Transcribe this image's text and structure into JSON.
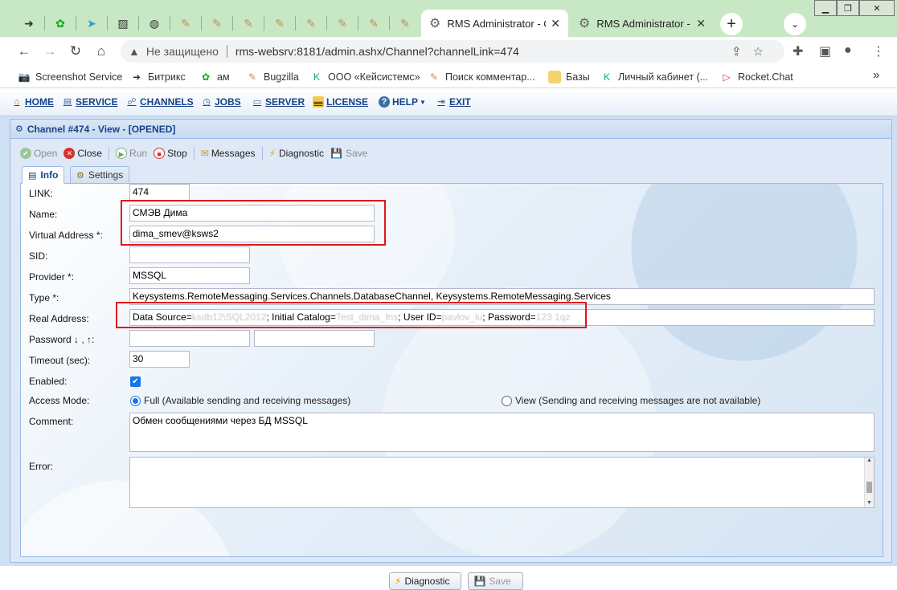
{
  "browser": {
    "tabs": [
      {
        "title": "RMS Administrator - C",
        "active": true
      },
      {
        "title": "RMS Administrator - N",
        "active": false
      }
    ],
    "address": {
      "security_label": "Не защищено",
      "url": "rms-websrv:8181/admin.ashx/Channel?channelLink=474"
    },
    "bookmarks": [
      "Screenshot Service",
      "Битрикс",
      "ам",
      "Bugzilla",
      "ООО «Кейсистемс»",
      "Поиск комментар...",
      "Базы",
      "Личный кабинет (...",
      "Rocket.Chat"
    ],
    "bookmarks_more": "»"
  },
  "menu": {
    "home": "HOME",
    "service": "SERVICE",
    "channels": "CHANNELS",
    "jobs": "JOBS",
    "server": "SERVER",
    "license": "LICENSE",
    "help": "HELP",
    "exit": "EXIT"
  },
  "panel": {
    "title": "Channel #474 - View - [OPENED]",
    "toolbar": {
      "open": "Open",
      "close": "Close",
      "run": "Run",
      "stop": "Stop",
      "messages": "Messages",
      "diagnostic": "Diagnostic",
      "save": "Save"
    },
    "tabs": {
      "info": "Info",
      "settings": "Settings"
    }
  },
  "form": {
    "link": {
      "label": "LINK:",
      "value": "474"
    },
    "name": {
      "label": "Name:",
      "value": "СМЭВ Дима"
    },
    "virtual_address": {
      "label": "Virtual Address *:",
      "value": "dima_smev@ksws2"
    },
    "sid": {
      "label": "SID:",
      "value": ""
    },
    "provider": {
      "label": "Provider *:",
      "value": "MSSQL"
    },
    "type": {
      "label": "Type *:",
      "value": "Keysystems.RemoteMessaging.Services.Channels.DatabaseChannel, Keysystems.RemoteMessaging.Services"
    },
    "real_address": {
      "label": "Real Address:",
      "parts": [
        {
          "text": "Data Source=",
          "blur": false
        },
        {
          "text": "ksdb12\\SQL2012",
          "blur": true
        },
        {
          "text": "; Initial Catalog=",
          "blur": false
        },
        {
          "text": "Test_dima_fns",
          "blur": true
        },
        {
          "text": "; User ID=",
          "blur": false
        },
        {
          "text": "pavlov_lu",
          "blur": true
        },
        {
          "text": "; Password=",
          "blur": false
        },
        {
          "text": "123 1qz",
          "blur": true
        }
      ]
    },
    "password": {
      "label": "Password ↓ , ↑:"
    },
    "timeout": {
      "label": "Timeout (sec):",
      "value": "30"
    },
    "enabled": {
      "label": "Enabled:",
      "checked": true
    },
    "access_mode": {
      "label": "Access Mode:",
      "full": "Full (Available sending and receiving messages)",
      "view": "View (Sending and receiving messages are not available)",
      "selected": "full"
    },
    "comment": {
      "label": "Comment:",
      "value": "Обмен сообщениями через БД MSSQL"
    },
    "error": {
      "label": "Error:",
      "value": ""
    }
  },
  "footer": {
    "diagnostic": "Diagnostic",
    "save": "Save"
  },
  "colors": {
    "tabbar": "#c8e7c4",
    "menu_text": "#15428b",
    "highlight": "#e0151d",
    "checkbox": "#1a73e8"
  }
}
